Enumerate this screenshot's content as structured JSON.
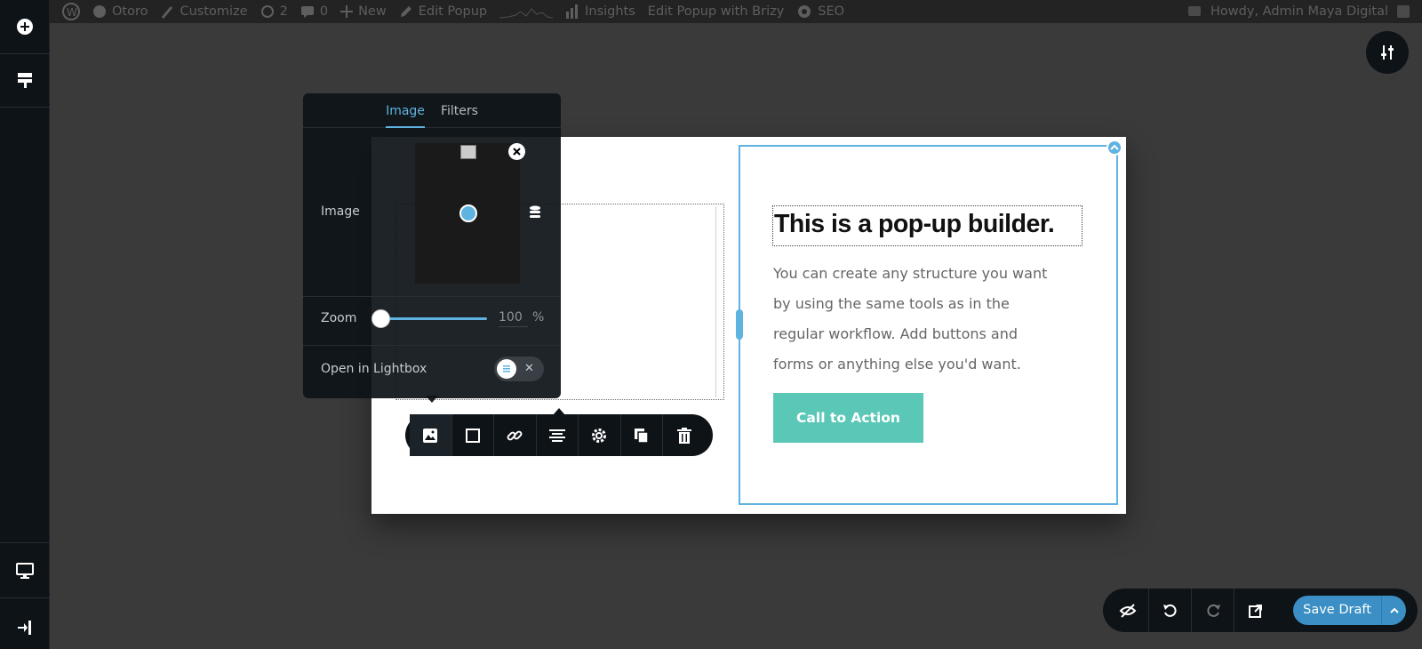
{
  "adminbar": {
    "items": [
      "Otoro",
      "Customize",
      "2",
      "0",
      "New",
      "Edit Popup",
      "Insights",
      "Edit Popup with Brizy",
      "SEO"
    ],
    "greeting": "Howdy, Admin Maya Digital"
  },
  "panel": {
    "tabs": [
      "Image",
      "Filters"
    ],
    "active_tab": "Image",
    "image_label": "Image",
    "zoom_label": "Zoom",
    "zoom_value": "100",
    "zoom_unit": "%",
    "zoom_percent": 100,
    "lightbox_label": "Open in Lightbox",
    "lightbox_enabled": false
  },
  "popup": {
    "heading": "This is a pop-up builder.",
    "body_lines": [
      "You can create any structure you want",
      "by using the same tools as in the",
      "regular workflow. Add buttons and",
      "forms or anything else you'd want."
    ],
    "cta_label": "Call to Action"
  },
  "toolbar": {
    "tools": [
      "image-icon",
      "border-icon",
      "link-icon",
      "align-icon",
      "gear-icon",
      "duplicate-icon",
      "trash-icon"
    ]
  },
  "bottombar": {
    "save_label": "Save Draft"
  },
  "colors": {
    "accent": "#5fb3e0",
    "cta": "#5bc8b7",
    "save": "#3b8fc4",
    "panel_bg": "#0e1318",
    "canvas_bg": "#3a3a3a"
  }
}
